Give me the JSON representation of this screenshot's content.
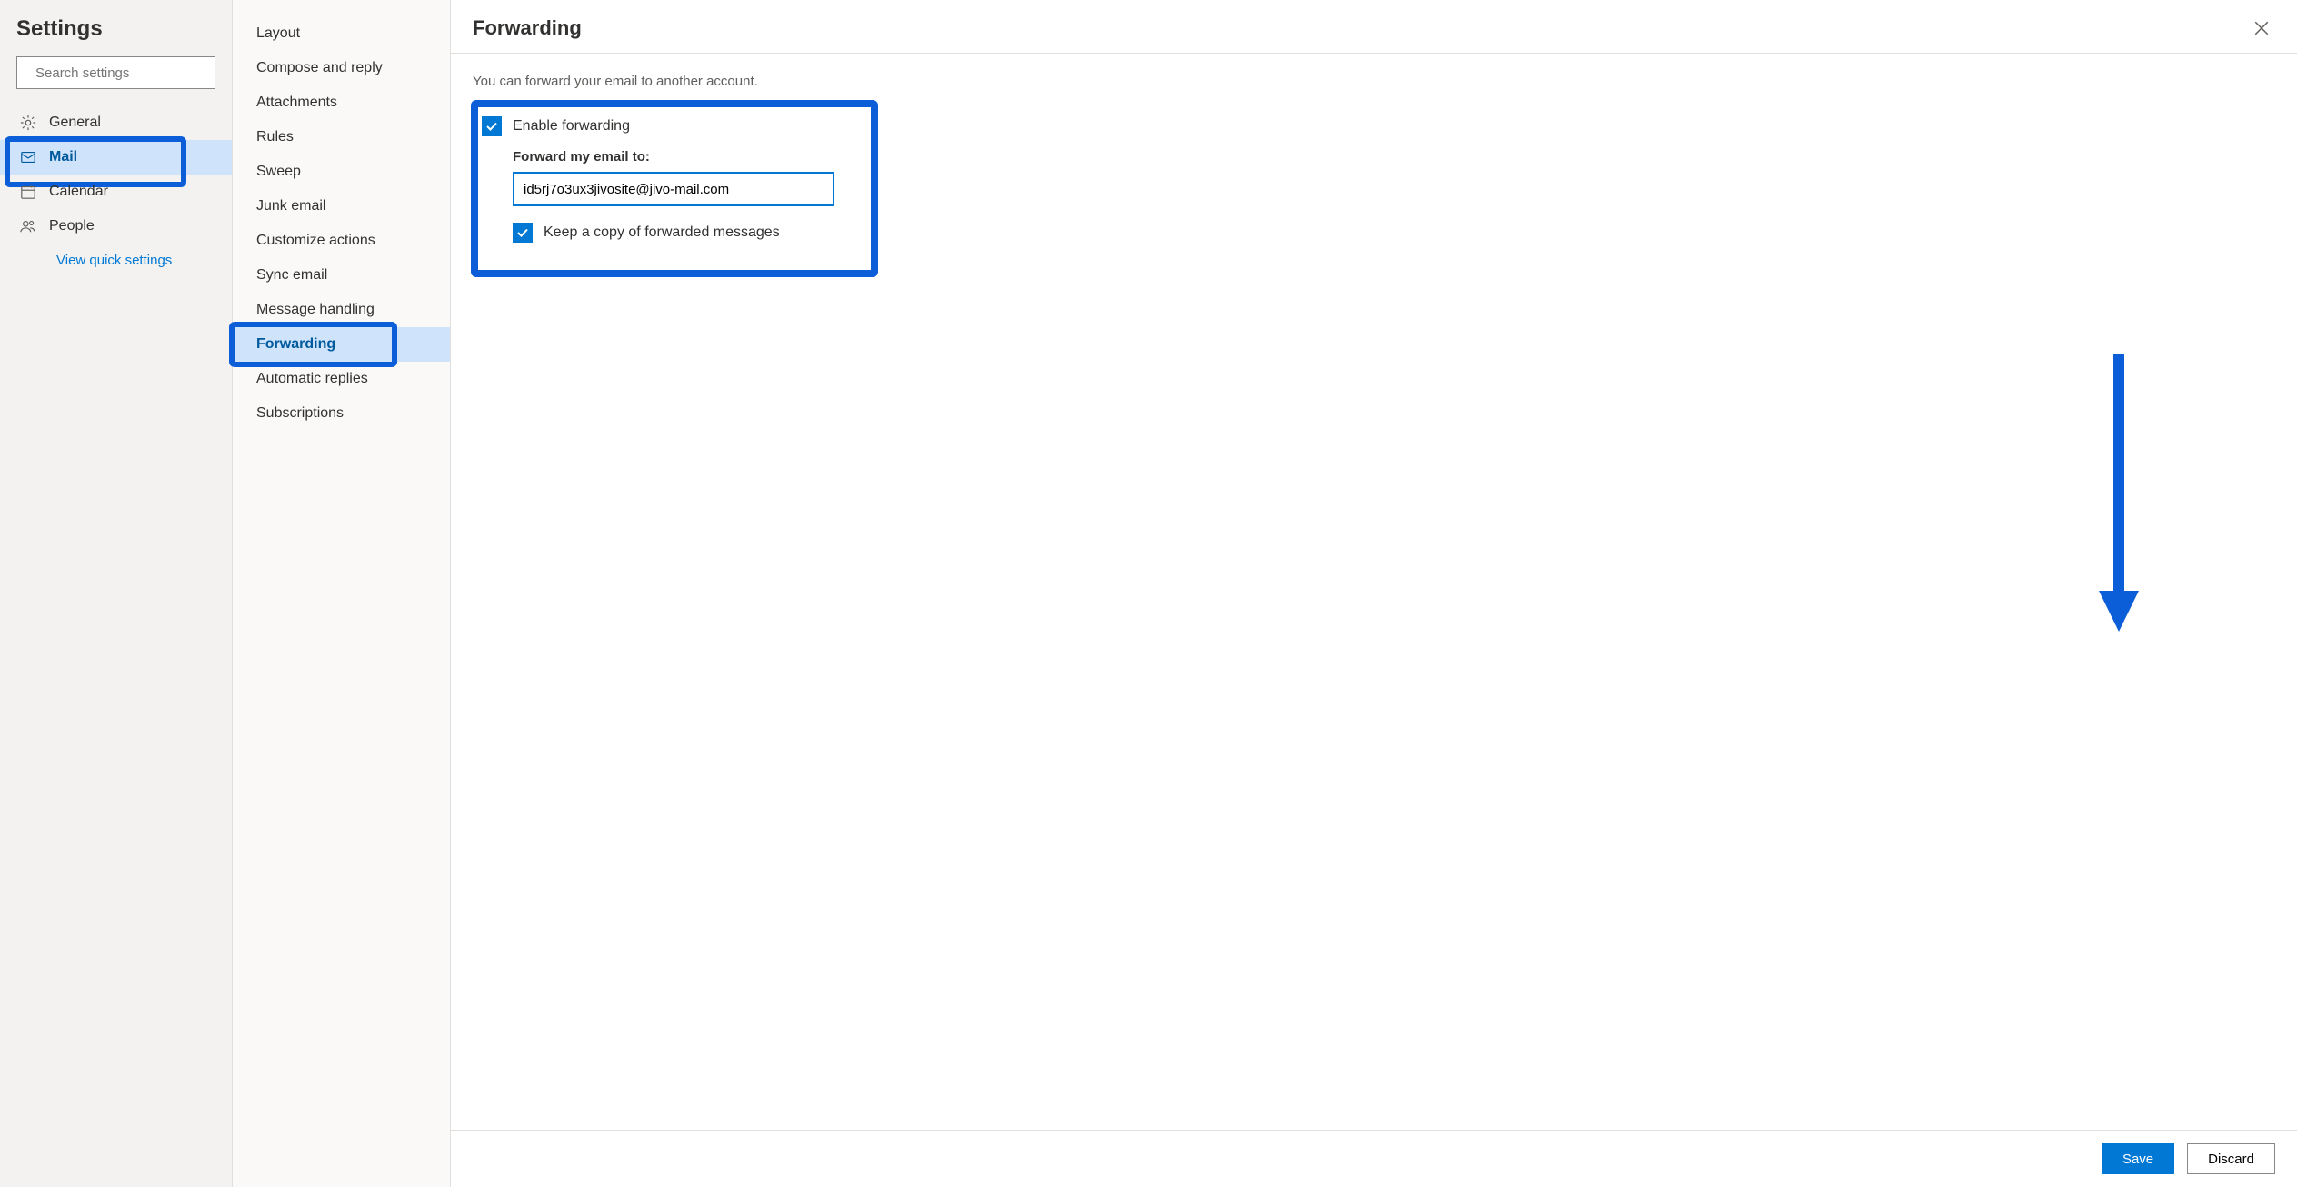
{
  "sidebar": {
    "title": "Settings",
    "search_placeholder": "Search settings",
    "categories": [
      {
        "id": "general",
        "label": "General",
        "icon": "gear"
      },
      {
        "id": "mail",
        "label": "Mail",
        "icon": "mail",
        "active": true
      },
      {
        "id": "calendar",
        "label": "Calendar",
        "icon": "calendar"
      },
      {
        "id": "people",
        "label": "People",
        "icon": "people"
      }
    ],
    "quick_link": "View quick settings"
  },
  "subnav": {
    "items": [
      {
        "id": "layout",
        "label": "Layout"
      },
      {
        "id": "compose",
        "label": "Compose and reply"
      },
      {
        "id": "attachments",
        "label": "Attachments"
      },
      {
        "id": "rules",
        "label": "Rules"
      },
      {
        "id": "sweep",
        "label": "Sweep"
      },
      {
        "id": "junk",
        "label": "Junk email"
      },
      {
        "id": "customize",
        "label": "Customize actions"
      },
      {
        "id": "sync",
        "label": "Sync email"
      },
      {
        "id": "handling",
        "label": "Message handling"
      },
      {
        "id": "forwarding",
        "label": "Forwarding",
        "active": true
      },
      {
        "id": "autoreply",
        "label": "Automatic replies"
      },
      {
        "id": "subs",
        "label": "Subscriptions"
      }
    ]
  },
  "main": {
    "title": "Forwarding",
    "intro": "You can forward your email to another account.",
    "enable_label": "Enable forwarding",
    "enable_checked": true,
    "forward_to_label": "Forward my email to:",
    "forward_to_value": "id5rj7o3ux3jivosite@jivo-mail.com",
    "keep_copy_label": "Keep a copy of forwarded messages",
    "keep_copy_checked": true,
    "footer": {
      "save": "Save",
      "discard": "Discard"
    }
  },
  "colors": {
    "accent": "#0078d4",
    "annotation": "#0b5ed7"
  }
}
